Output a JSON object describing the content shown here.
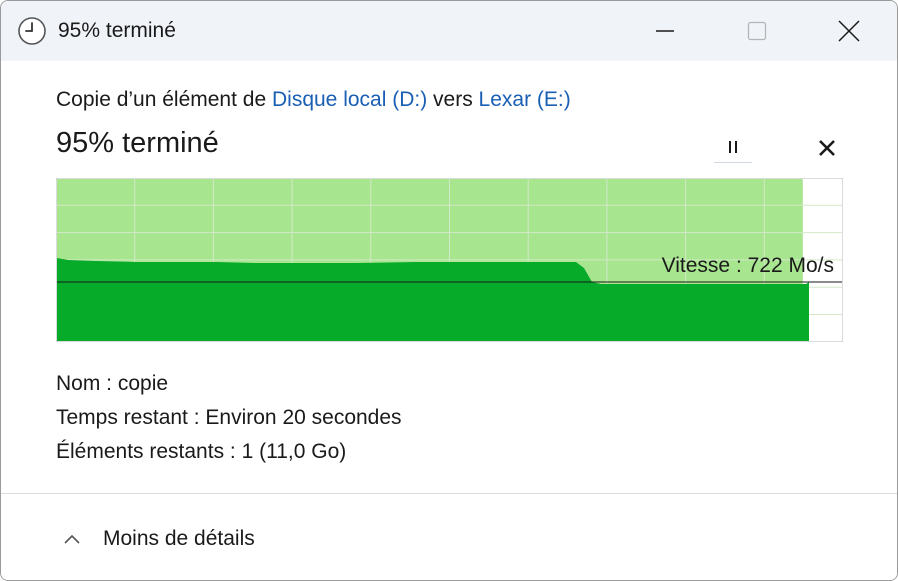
{
  "window": {
    "title": "95% terminé"
  },
  "copy": {
    "prefix": "Copie d’un élément de ",
    "source": "Disque local (D:)",
    "middle": " vers ",
    "destination": "Lexar (E:)"
  },
  "progress": {
    "label": "95% terminé",
    "percent": 95
  },
  "speed": {
    "label": "Vitesse : 722 Mo/s"
  },
  "details": {
    "name_label": "Nom :",
    "name_value": "copie",
    "time_label": "Temps restant :",
    "time_value": "Environ 20 secondes",
    "items_label": "Éléments restants :",
    "items_value": "1 (11,0 Go)"
  },
  "footer": {
    "less_details_label": "Moins de détails"
  },
  "colors": {
    "chart_fill": "#06ab2a",
    "chart_bg": "#a7e58f",
    "link": "#1a5fb4",
    "titlebar": "#f0f4f9"
  },
  "icons": {
    "app": "clock-icon",
    "minimize": "minimize-icon",
    "maximize": "maximize-icon",
    "close": "close-icon",
    "pause": "pause-icon",
    "cancel": "cancel-icon",
    "collapse": "chevron-up-icon"
  }
}
